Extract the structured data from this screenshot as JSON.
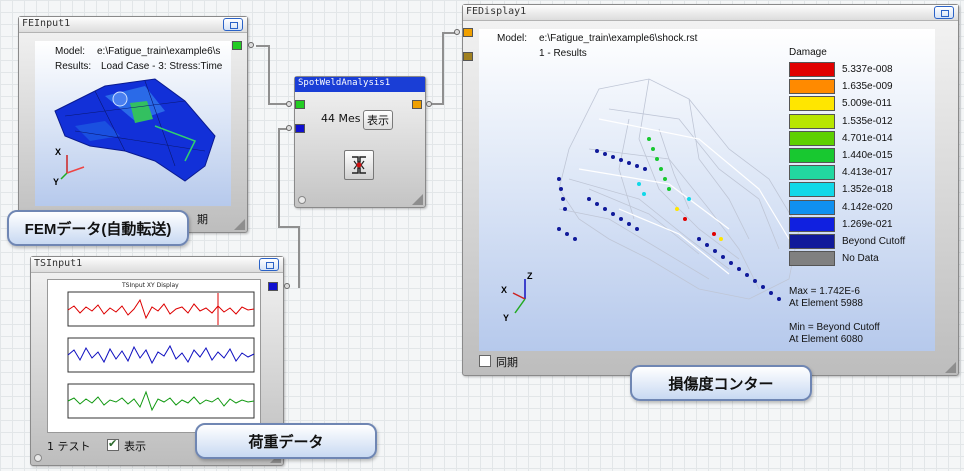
{
  "nodes": {
    "fe_input": {
      "title": "FEInput1",
      "model_label": "Model:",
      "model_path": "e:\\Fatigue_train\\example6\\s",
      "results_label": "Results:",
      "results_value": "Load Case - 3: Stress:Time",
      "peek_text": "期"
    },
    "spotweld": {
      "title": "SpotWeldAnalysis1",
      "count_text": "44 Mes",
      "show_button": "表示"
    },
    "ts_input": {
      "title": "TSInput1",
      "plot_title": "TSInput XY Display",
      "count_text": "1 テスト",
      "show_label": "表示"
    },
    "fe_display": {
      "title": "FEDisplay1",
      "model_label": "Model:",
      "model_path": "e:\\Fatigue_train\\example6\\shock.rst",
      "results_line": "1 - Results",
      "legend_title": "Damage",
      "legend": [
        {
          "color": "#e00000",
          "label": "5.337e-008"
        },
        {
          "color": "#ff8a00",
          "label": "1.635e-009"
        },
        {
          "color": "#ffe600",
          "label": "5.009e-011"
        },
        {
          "color": "#b8e600",
          "label": "1.535e-012"
        },
        {
          "color": "#5ed000",
          "label": "4.701e-014"
        },
        {
          "color": "#18c830",
          "label": "1.440e-015"
        },
        {
          "color": "#22d8a0",
          "label": "4.413e-017"
        },
        {
          "color": "#10d8e8",
          "label": "1.352e-018"
        },
        {
          "color": "#1090f0",
          "label": "4.142e-020"
        },
        {
          "color": "#1020e0",
          "label": "1.269e-021"
        },
        {
          "color": "#101a9a",
          "label": "Beyond Cutoff"
        },
        {
          "color": "#808080",
          "label": "No Data"
        }
      ],
      "max_line1": "Max = 1.742E-6",
      "max_line2": "At Element 5988",
      "min_line1": "Min = Beyond Cutoff",
      "min_line2": "At Element 6080",
      "sync_label": "同期",
      "axis_x": "X",
      "axis_y": "Y",
      "axis_z": "Z"
    }
  },
  "callouts": {
    "fem": "FEMデータ(自動転送)",
    "load": "荷重データ",
    "damage": "損傷度コンター"
  },
  "axes_fe_input": {
    "x": "X",
    "y": "Y"
  },
  "colors": {
    "port_green": "#22cc22",
    "port_blue": "#1010d0",
    "port_orange": "#f0a000",
    "port_olive": "#a08020",
    "title_blue": "#1a3ed6"
  }
}
